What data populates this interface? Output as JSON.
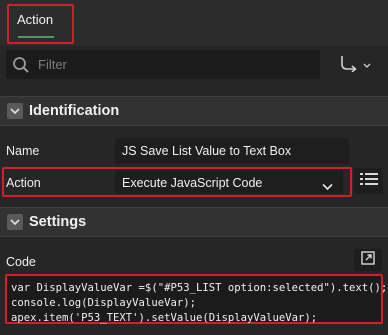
{
  "tabs": {
    "active_label": "Action"
  },
  "filter": {
    "placeholder": "Filter"
  },
  "identification": {
    "title": "Identification",
    "name_label": "Name",
    "name_value": "JS Save List Value to Text Box",
    "action_label": "Action",
    "action_value": "Execute JavaScript Code"
  },
  "settings": {
    "title": "Settings",
    "code_label": "Code",
    "code_lines": [
      "var DisplayValueVar =$(\"#P53_LIST option:selected\").text();",
      "console.log(DisplayValueVar);",
      "apex.item('P53_TEXT').setValue(DisplayValueVar);"
    ]
  },
  "colors": {
    "highlight": "#d0212a",
    "tab_underline": "#4f9960",
    "background": "#262626"
  }
}
